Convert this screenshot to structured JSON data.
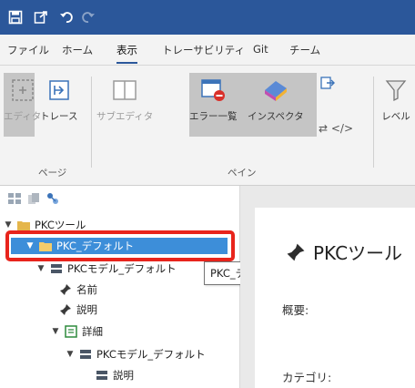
{
  "ribbon_tabs": [
    "ファイル",
    "ホーム",
    "表示",
    "トレーサビリティ",
    "Git",
    "チーム"
  ],
  "ribbon": {
    "editor_label": "エディタ",
    "trace_label": "トレース",
    "subeditor_label": "サブエディタ",
    "errorlist_label": "エラー一覧",
    "inspector_label": "インスペクタ",
    "level_label": "レベル",
    "group_page": "ページ",
    "group_pane": "ペイン"
  },
  "tree": {
    "root": "PKCツール",
    "default": "PKC_デフォルト",
    "model": "PKCモデル_デフォルト",
    "name": "名前",
    "description": "説明",
    "detail": "詳細",
    "model2": "PKCモデル_デフォルト",
    "description2": "説明"
  },
  "tooltip": "PKC_デフォルト",
  "document": {
    "title": "PKCツール",
    "overview_label": "概要:",
    "category_label": "カテゴリ:"
  },
  "colors": {
    "title_bar": "#2b579a",
    "selection": "#3d8ed9",
    "highlight_box": "#e8241c"
  }
}
